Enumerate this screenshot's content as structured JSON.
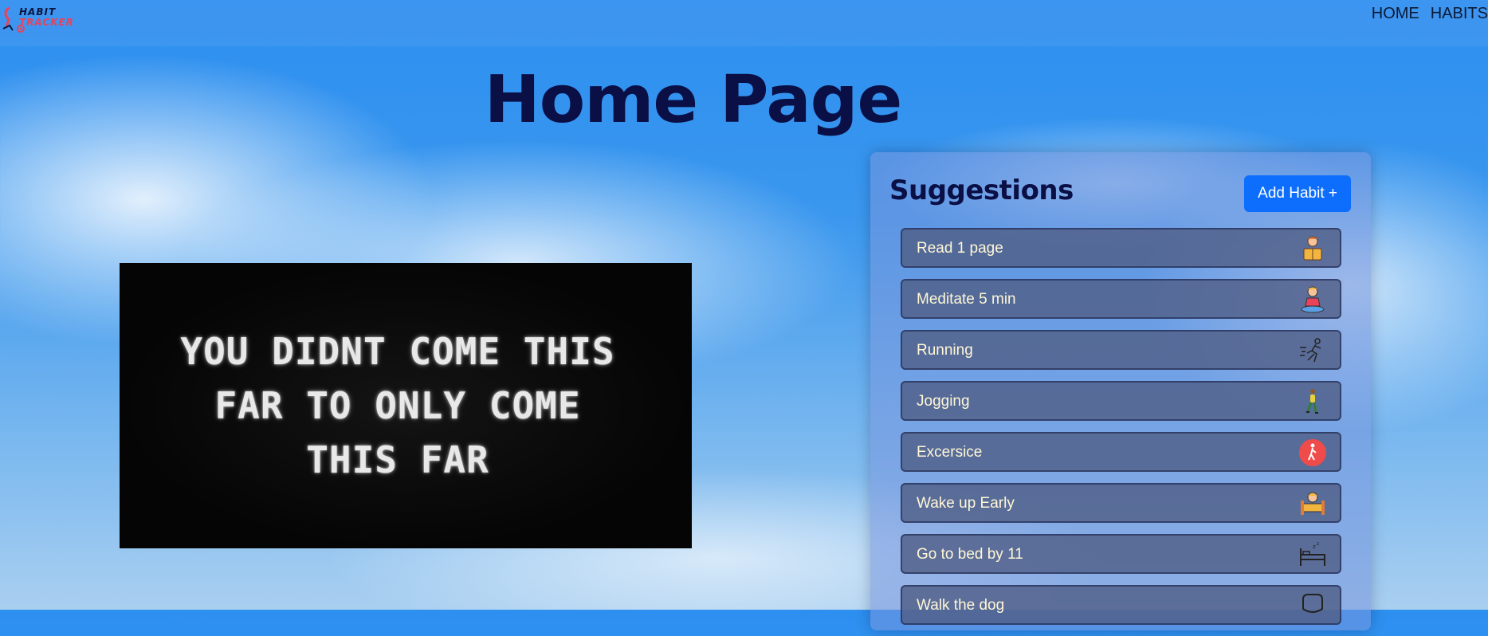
{
  "brand": {
    "line1": "HABIT",
    "line2": "TRACKER"
  },
  "nav": {
    "home": "HOME",
    "habits": "HABITS"
  },
  "page_title": "Home Page",
  "quote": {
    "line1": "YOU DIDNT COME THIS",
    "line2": "FAR TO ONLY COME",
    "line3": "THIS FAR"
  },
  "suggestions": {
    "title": "Suggestions",
    "add_label": "Add Habit +",
    "items": [
      {
        "label": "Read 1 page",
        "icon": "reading-person-icon"
      },
      {
        "label": "Meditate 5 min",
        "icon": "meditation-icon"
      },
      {
        "label": "Running",
        "icon": "running-icon"
      },
      {
        "label": "Jogging",
        "icon": "jogging-icon"
      },
      {
        "label": "Excersice",
        "icon": "exercise-icon"
      },
      {
        "label": "Wake up Early",
        "icon": "wake-up-icon"
      },
      {
        "label": "Go to bed by 11",
        "icon": "sleep-bed-icon"
      },
      {
        "label": "Walk the dog",
        "icon": "dog-icon"
      }
    ]
  },
  "colors": {
    "accent": "#0d6efd",
    "title": "#0a0f45",
    "logo_red": "#e9425a"
  }
}
